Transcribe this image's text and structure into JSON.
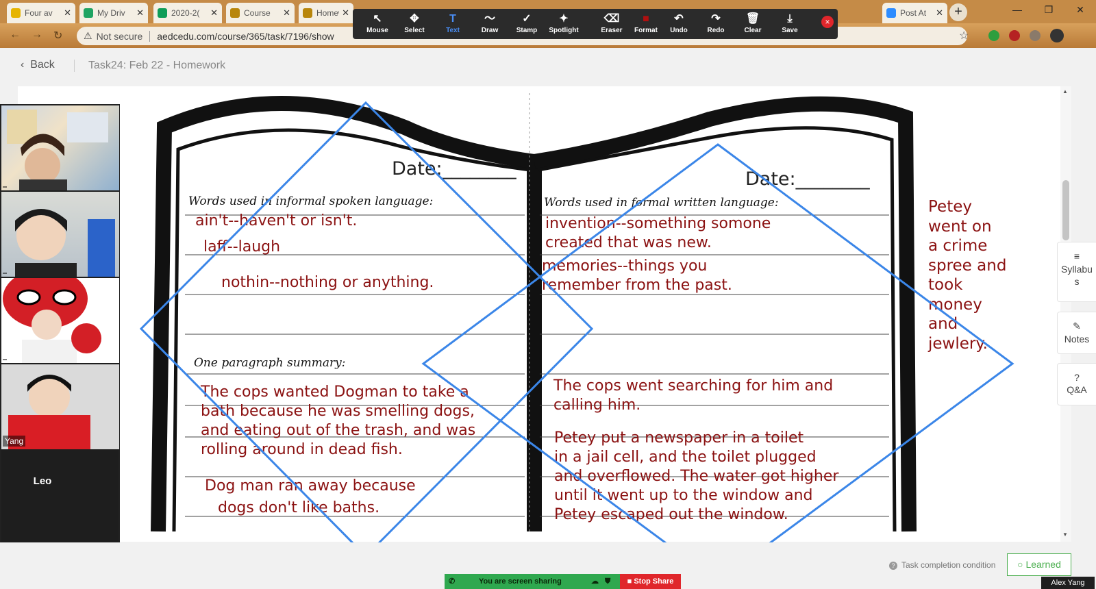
{
  "browser": {
    "tabs": [
      {
        "label": "Four av",
        "color": "#e6b400"
      },
      {
        "label": "My Driv",
        "color": "#1fa463"
      },
      {
        "label": "2020-2(",
        "color": "#0f9d58"
      },
      {
        "label": "Course",
        "color": "#b8860b"
      },
      {
        "label": "Homew",
        "color": "#b8860b"
      },
      {
        "label": "Post At",
        "color": "#2d8cff"
      }
    ],
    "security_label": "Not secure",
    "url": "aedcedu.com/course/365/task/7196/show"
  },
  "page": {
    "back_label": "Back",
    "task_title": "Task24:  Feb 22 - Homework"
  },
  "annotation_toolbar": {
    "tools": [
      {
        "label": "Mouse",
        "icon": "↖"
      },
      {
        "label": "Select",
        "icon": "✥"
      },
      {
        "label": "Text",
        "icon": "T",
        "active": true
      },
      {
        "label": "Draw",
        "icon": "〜"
      },
      {
        "label": "Stamp",
        "icon": "✓"
      },
      {
        "label": "Spotlight",
        "icon": "✦"
      },
      {
        "label": "Eraser",
        "icon": "⌫"
      },
      {
        "label": "Format",
        "icon": "■"
      },
      {
        "label": "Undo",
        "icon": "↶"
      },
      {
        "label": "Redo",
        "icon": "↷"
      },
      {
        "label": "Clear",
        "icon": "🗑"
      },
      {
        "label": "Save",
        "icon": "⤓"
      }
    ],
    "close_icon": "×",
    "active_color": "#4a8ef5",
    "format_color": "#b01010"
  },
  "video_tiles": [
    {
      "name": ""
    },
    {
      "name": ""
    },
    {
      "name": ""
    },
    {
      "name": "Yang"
    }
  ],
  "video_leo": "Leo",
  "worksheet": {
    "left_date_label": "Date:________",
    "right_date_label": "Date:________",
    "left_heading": "Words used in informal spoken language:",
    "right_heading": "Words used in formal written language:",
    "summary_heading": "One paragraph summary:",
    "left_entries": [
      "ain't--haven't or isn't.",
      "laff--laugh",
      "nothin--nothing or anything."
    ],
    "right_entries": [
      "invention--something somone",
      "created that was new.",
      "memories--things you",
      "remember from the past."
    ],
    "left_summary": [
      "The cops wanted Dogman to take a",
      "bath because he was smelling dogs,",
      "and eating out of the trash, and was",
      "rolling around in dead fish."
    ],
    "left_summary_2": [
      "Dog man ran away because",
      "dogs don't like baths."
    ],
    "right_summary": [
      "The cops went searching for him and",
      "calling him."
    ],
    "right_summary_2": [
      "Petey put a newspaper in a toilet",
      "in a jail cell, and the toilet plugged",
      "and overflowed.  The water got higher",
      "until it went up to the window and",
      "Petey escaped out the window."
    ],
    "margin_note": [
      "Petey",
      "went on",
      "a crime",
      "spree and",
      "took",
      "money",
      "and",
      "jewlery."
    ],
    "annotation_text_color": "#8b1212",
    "annotation_shape_color": "#3b86e8"
  },
  "side_panel": [
    {
      "label": "Syllabu\ns",
      "icon": "≡"
    },
    {
      "label": "Notes",
      "icon": "✎"
    },
    {
      "label": "Q&A",
      "icon": "?"
    }
  ],
  "footer": {
    "task_completion": "Task completion condition",
    "learned": "Learned",
    "user": "Alex Yang",
    "sharing": "You are screen sharing",
    "stop_share": "Stop Share"
  }
}
